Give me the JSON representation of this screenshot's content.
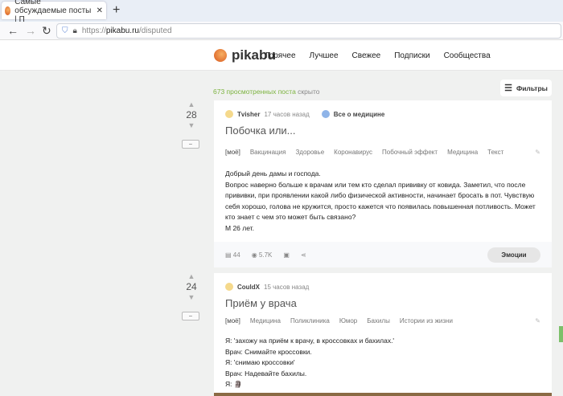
{
  "browser": {
    "tab_title": "Самые обсуждаемые посты | П",
    "url_prefix": "https://",
    "url_domain": "pikabu.ru",
    "url_path": "/disputed"
  },
  "header": {
    "logo": "pikabu",
    "nav": [
      "Горячее",
      "Лучшее",
      "Свежее",
      "Подписки",
      "Сообщества"
    ]
  },
  "hidden": {
    "count": "673 просмотренных поста",
    "suffix": "скрыто"
  },
  "filters_label": "Фильтры",
  "posts": [
    {
      "rating": "28",
      "author": "Tvisher",
      "time": "17 часов назад",
      "community": "Все о медицине",
      "title": "Побочка или...",
      "tags": [
        "[моё]",
        "Вакцинация",
        "Здоровье",
        "Коронавирус",
        "Побочный эффект",
        "Медицина",
        "Текст"
      ],
      "lines": [
        "Добрый день дамы и господа.",
        "Вопрос наверно больше к врачам или тем кто сделал прививку от ковида. Заметил, что после прививки, при проявлении какой либо физической активности, начинает бросать в пот. Чувствую себя хорошо, голова не кружится, просто кажется что появилась повышенная потливость. Может кто знает с чем это может быть связано?",
        "М 26 лет."
      ],
      "comments": "44",
      "views": "5.7K",
      "emotions": "Эмоции"
    },
    {
      "rating": "24",
      "author": "CouldX",
      "time": "15 часов назад",
      "title": "Приём у врача",
      "tags": [
        "[моё]",
        "Медицина",
        "Поликлиника",
        "Юмор",
        "Бахилы",
        "Истории из жизни"
      ],
      "lines": [
        "Я: 'захожу на приём к врачу, в кроссовках и бахилах.'",
        "Врач: Снимайте кроссовки.",
        "Я: 'снимаю кроссовки'",
        "Врач: Надевайте бахилы.",
        "Я: 🗿"
      ]
    }
  ]
}
